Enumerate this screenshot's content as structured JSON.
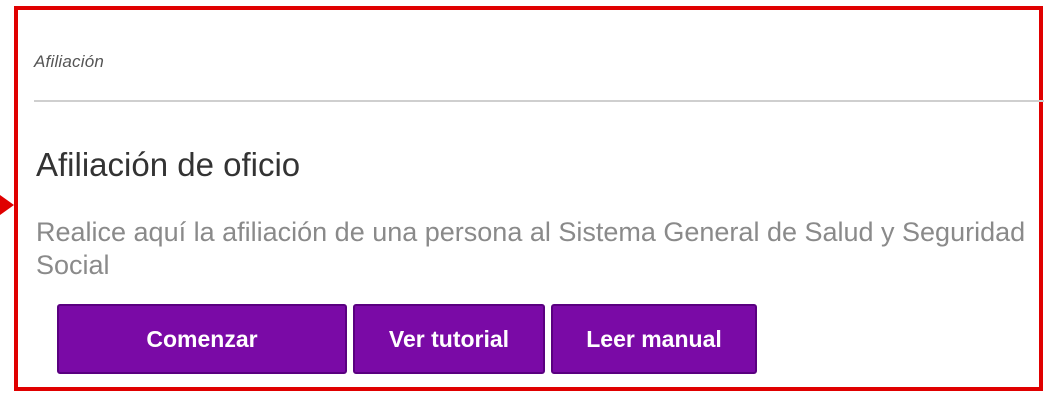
{
  "panel": {
    "breadcrumb": "Afiliación",
    "title": "Afiliación de oficio",
    "description": "Realice aquí la afiliación de una persona al Sistema General de Salud y Seguridad Social"
  },
  "buttons": {
    "start": "Comenzar",
    "tutorial": "Ver tutorial",
    "manual": "Leer manual"
  },
  "colors": {
    "highlight_border": "#e00000",
    "button_background": "#7a0aa6",
    "button_text": "#ffffff"
  },
  "icons": {
    "pointer": "arrow-right-icon"
  }
}
